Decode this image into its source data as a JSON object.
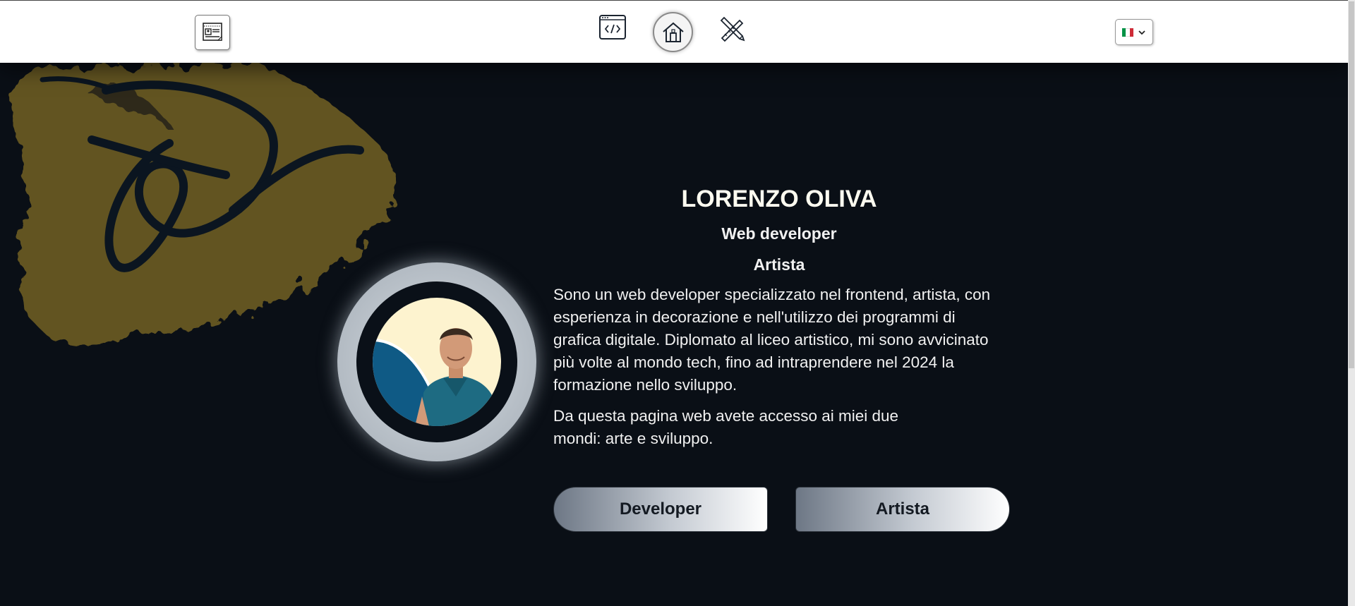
{
  "nav": {
    "buttons": [
      {
        "name": "cv-button",
        "icon": "resume-icon"
      },
      {
        "name": "developer-nav-button",
        "icon": "code-window-icon"
      },
      {
        "name": "home-button",
        "icon": "house-icon"
      },
      {
        "name": "art-nav-button",
        "icon": "pencil-ruler-icon"
      }
    ],
    "language": {
      "flag": "italy-flag-icon",
      "chevron": "chevron-down-icon",
      "flag_colors": [
        "#009246",
        "#ffffff",
        "#ce2b37"
      ]
    }
  },
  "hero": {
    "name": "LORENZO OLIVA",
    "role1": "Web developer",
    "role2": "Artista",
    "bio": "Sono un web developer specializzato nel frontend, artista, con esperienza in decorazione e nell'utilizzo dei programmi di grafica digitale. Diplomato al liceo artistico, mi sono avvicinato più volte al mondo tech, fino ad intraprendere nel 2024 la formazione nello sviluppo.",
    "bio2": "Da questa pagina web avete accesso ai miei due mondi: arte e sviluppo.",
    "buttons": {
      "developer": "Developer",
      "artist": "Artista"
    }
  },
  "colors": {
    "background": "#0a0f16",
    "navbar": "#ffffff",
    "accent_gold": "#6b5a22",
    "button_text": "#141a22"
  }
}
